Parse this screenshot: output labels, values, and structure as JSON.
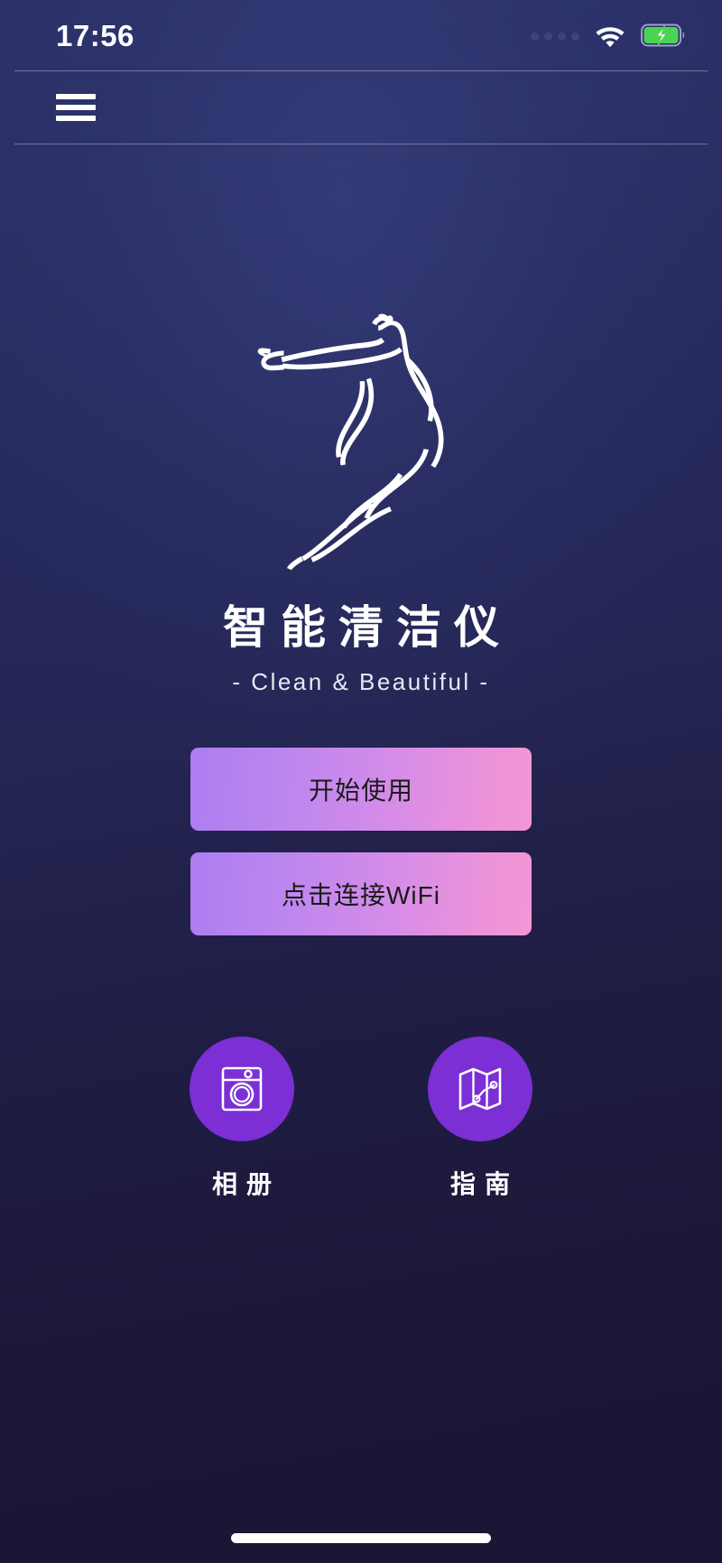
{
  "status_bar": {
    "time": "17:56",
    "signal_dots_count": 4,
    "signal_icon": "signal-dots-icon",
    "wifi_icon": "wifi-icon",
    "battery_icon": "battery-charging-icon",
    "battery_color": "#4cd353",
    "battery_charging": true
  },
  "nav_bar": {
    "menu_icon": "hamburger-menu-icon"
  },
  "branding": {
    "logo_icon": "dancer-silhouette-logo",
    "title": "智能清洁仪",
    "subtitle": "- Clean & Beautiful -"
  },
  "actions": {
    "primary_label": "开始使用",
    "secondary_label": "点击连接WiFi",
    "gradient_start": "#ac7df0",
    "gradient_end": "#f396d6"
  },
  "shortcuts": [
    {
      "label": "相册",
      "icon": "washing-machine-icon",
      "circle_color": "#7b2fd4"
    },
    {
      "label": "指南",
      "icon": "folded-map-icon",
      "circle_color": "#7b2fd4"
    }
  ],
  "system": {
    "home_indicator": "home-indicator-bar"
  },
  "theme": {
    "background_top": "#2b3068",
    "background_bottom": "#191534",
    "accent_purple": "#7b2fd4",
    "text_primary": "#ffffff"
  }
}
